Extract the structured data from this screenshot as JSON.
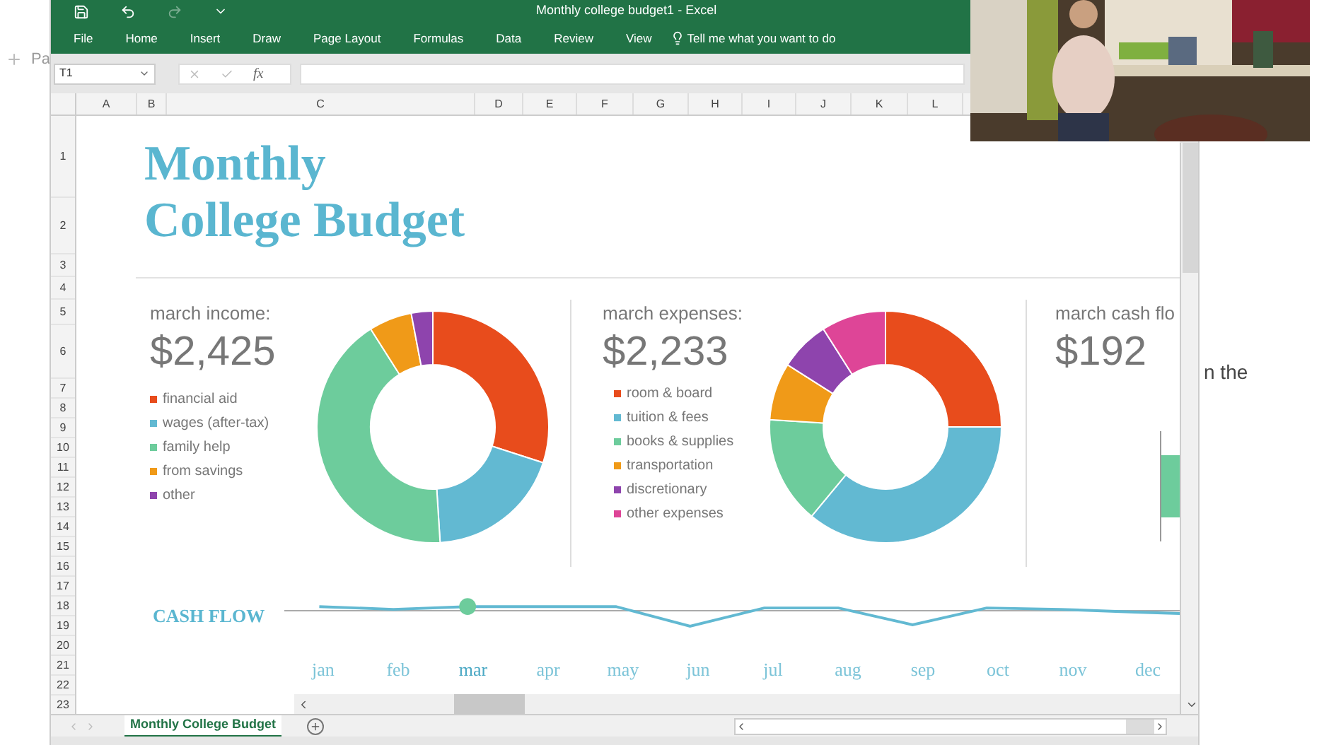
{
  "background": {
    "new_tab_label": "Pa",
    "side_text": "n the"
  },
  "window": {
    "title": "Monthly college budget1  -  Excel"
  },
  "ribbon_tabs": [
    {
      "label": "File"
    },
    {
      "label": "Home"
    },
    {
      "label": "Insert"
    },
    {
      "label": "Draw"
    },
    {
      "label": "Page Layout"
    },
    {
      "label": "Formulas"
    },
    {
      "label": "Data"
    },
    {
      "label": "Review"
    },
    {
      "label": "View"
    }
  ],
  "tell_me": {
    "placeholder": "Tell me what you want to do"
  },
  "formula_bar": {
    "name_box": "T1",
    "fx": "fx"
  },
  "columns": [
    "A",
    "B",
    "C",
    "D",
    "E",
    "F",
    "G",
    "H",
    "I",
    "J",
    "K",
    "L"
  ],
  "rows": [
    "1",
    "2",
    "3",
    "4",
    "5",
    "6",
    "7",
    "8",
    "9",
    "10",
    "11",
    "12",
    "13",
    "14",
    "15",
    "16",
    "17",
    "18",
    "19",
    "20",
    "21",
    "22",
    "23"
  ],
  "dashboard": {
    "title_lines": [
      "Monthly",
      "College Budget"
    ],
    "income": {
      "label": "march income:",
      "total": "$2,425",
      "legend": [
        {
          "label": "financial aid",
          "color": "#e84c1c"
        },
        {
          "label": "wages (after-tax)",
          "color": "#62b9d2"
        },
        {
          "label": "family help",
          "color": "#6dcc9c"
        },
        {
          "label": "from savings",
          "color": "#f09a18"
        },
        {
          "label": "other",
          "color": "#8e44ad"
        }
      ]
    },
    "expenses": {
      "label": "march expenses:",
      "total": "$2,233",
      "legend": [
        {
          "label": "room & board",
          "color": "#e84c1c"
        },
        {
          "label": "tuition & fees",
          "color": "#62b9d2"
        },
        {
          "label": "books & supplies",
          "color": "#6dcc9c"
        },
        {
          "label": "transportation",
          "color": "#f09a18"
        },
        {
          "label": "discretionary",
          "color": "#8e44ad"
        },
        {
          "label": "other expenses",
          "color": "#de4597"
        }
      ]
    },
    "cash_flow_panel": {
      "label": "march cash flo",
      "total": "$192"
    },
    "cash_flow": {
      "label": "CASH FLOW",
      "months": [
        {
          "label": "jan",
          "selected": false
        },
        {
          "label": "feb",
          "selected": false
        },
        {
          "label": "mar",
          "selected": true
        },
        {
          "label": "apr",
          "selected": false
        },
        {
          "label": "may",
          "selected": false
        },
        {
          "label": "jun",
          "selected": false
        },
        {
          "label": "jul",
          "selected": false
        },
        {
          "label": "aug",
          "selected": false
        },
        {
          "label": "sep",
          "selected": false
        },
        {
          "label": "oct",
          "selected": false
        },
        {
          "label": "nov",
          "selected": false
        },
        {
          "label": "dec",
          "selected": false
        }
      ]
    }
  },
  "sheet_tabs": [
    {
      "label": "Monthly College Budget",
      "selected": true
    }
  ]
}
